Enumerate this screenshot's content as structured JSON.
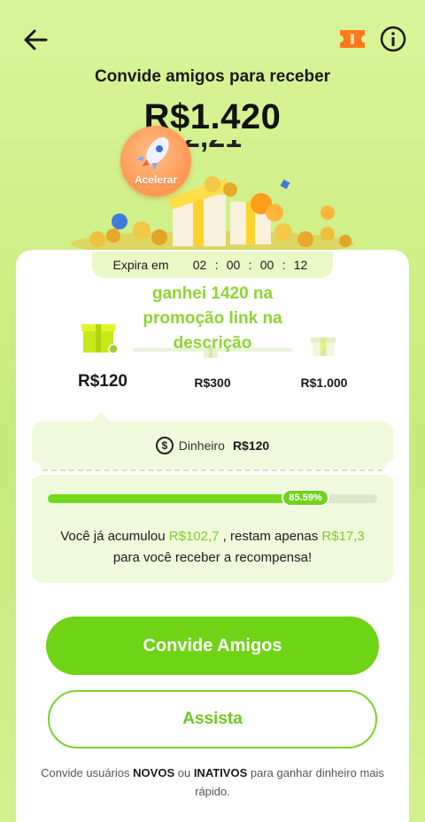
{
  "header": {
    "title": "Convide amigos para receber",
    "amount": "R$1.420",
    "amount_ghost": "2,21"
  },
  "boost": {
    "label": "Acelerar"
  },
  "expiry": {
    "label": "Expira em",
    "hours": "02",
    "minutes": "00",
    "seconds": "00",
    "frames": "12",
    "separator": ":"
  },
  "overlay": {
    "text": "ganhei 1420 na promoção link na descrição"
  },
  "tiers": [
    {
      "value": "R$120"
    },
    {
      "value": "R$300"
    },
    {
      "value": "R$1.000"
    }
  ],
  "cash": {
    "icon": "dollar-icon",
    "icon_glyph": "$",
    "label": "Dinheiro",
    "value": "R$120"
  },
  "progress": {
    "percent": 85.59,
    "badge": "85.59%"
  },
  "accumulated": {
    "prefix": "Você já acumulou ",
    "earned": "R$102,7",
    "middle": " , restam apenas ",
    "remaining": "R$17,3",
    "suffix": "para você receber a recompensa!"
  },
  "buttons": {
    "invite": "Convide Amigos",
    "watch": "Assista"
  },
  "footer": {
    "p1": "Convide usuários ",
    "novos": "NOVOS",
    "p2": " ou ",
    "inativos": "INATIVOS",
    "p3": " para ganhar dinheiro mais rápido."
  },
  "colors": {
    "accent": "#6fd316",
    "badge": "#ff8a44",
    "ticket": "#ff7a1a"
  }
}
